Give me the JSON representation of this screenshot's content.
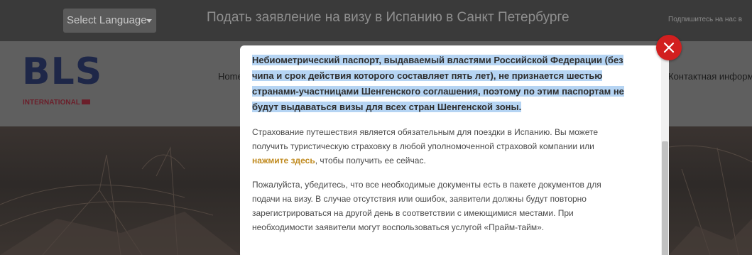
{
  "topbar": {
    "language_select": "Select Language",
    "title": "Подать заявление на визу в Испанию в Санкт Петербурге",
    "subscribe": "Подпишитесь на нас в"
  },
  "header": {
    "logo_text": "BLS",
    "logo_sub": "INTERNATIONAL",
    "nav_home": "Home",
    "nav_contact": "Контактная информ"
  },
  "modal": {
    "notice_lines": [
      "Небиометрический паспорт, выдаваемый властями Российской Федерации (без",
      "чипа и срок действия которого составляет пять лет), не признается шестью",
      "странами-участницами Шенгенского соглашения, поэтому по этим паспортам не",
      "будут выдаваться визы для всех стран Шенгенской зоны."
    ],
    "insurance_lines": [
      "Страхование путешествия является обязательным для поездки в Испанию. Вы можете",
      "получить туристическую страховку в любой уполномоченной страховой компании или"
    ],
    "insurance_link": "нажмите здесь",
    "insurance_tail": ", чтобы получить ее сейчас.",
    "documents_lines": [
      "Пожалуйста, убедитесь, что все необходимые документы есть в пакете документов для",
      "подачи на визу. В случае отсутствия или ошибок, заявители должны будут повторно",
      "зарегистрироваться на другой день в соответствии с имеющимися местами. При",
      "необходимости заявители могут воспользоваться услугой «Прайм-тайм»."
    ]
  },
  "colors": {
    "close_button": "#d21f1f",
    "link": "#c08a1e",
    "selection_highlight": "#b5d4f3",
    "logo_navy": "#1e2748",
    "logo_red": "#6b1e2a"
  },
  "icons": {
    "close": "close-icon",
    "dropdown": "caret-down-icon"
  }
}
